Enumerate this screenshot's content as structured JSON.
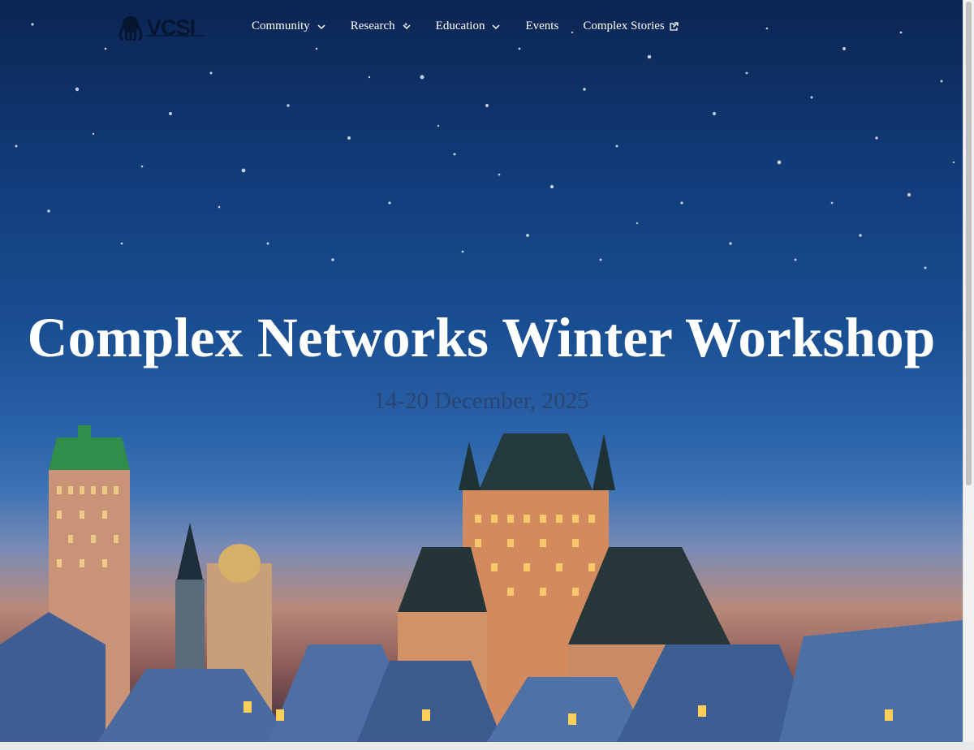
{
  "brand": {
    "logo_text": "VCSI"
  },
  "nav": {
    "items": [
      {
        "label": "Community",
        "dropdown": true
      },
      {
        "label": "Research",
        "dropdown": true
      },
      {
        "label": "Education",
        "dropdown": true
      },
      {
        "label": "Events",
        "dropdown": false
      },
      {
        "label": "Complex Stories",
        "external": true
      }
    ]
  },
  "hero": {
    "title": "Complex Networks Winter Workshop",
    "date": "14-20 December, 2025"
  }
}
